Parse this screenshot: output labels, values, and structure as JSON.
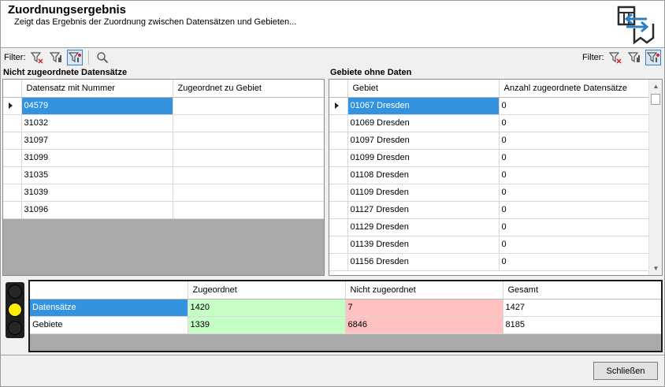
{
  "header": {
    "title": "Zuordnungsergebnis",
    "subtitle": "Zeigt das Ergebnis der Zuordnung zwischen Datensätzen und Gebieten..."
  },
  "filter_left": {
    "label": "Filter:"
  },
  "filter_right": {
    "label": "Filter:"
  },
  "left_panel": {
    "title": "Nicht zugeordnete Datensätze",
    "columns": [
      "Datensatz mit Nummer",
      "Zugeordnet zu Gebiet"
    ],
    "rows": [
      [
        "04579",
        ""
      ],
      [
        "31032",
        ""
      ],
      [
        "31097",
        ""
      ],
      [
        "31099",
        ""
      ],
      [
        "31035",
        ""
      ],
      [
        "31039",
        ""
      ],
      [
        "31096",
        ""
      ]
    ]
  },
  "right_panel": {
    "title": "Gebiete ohne Daten",
    "columns": [
      "Gebiet",
      "Anzahl zugeordnete Datensätze"
    ],
    "rows": [
      [
        "01067 Dresden",
        "0"
      ],
      [
        "01069 Dresden",
        "0"
      ],
      [
        "01097 Dresden",
        "0"
      ],
      [
        "01099 Dresden",
        "0"
      ],
      [
        "01108 Dresden",
        "0"
      ],
      [
        "01109 Dresden",
        "0"
      ],
      [
        "01127 Dresden",
        "0"
      ],
      [
        "01129 Dresden",
        "0"
      ],
      [
        "01139 Dresden",
        "0"
      ],
      [
        "01156 Dresden",
        "0"
      ]
    ]
  },
  "summary": {
    "columns": [
      "",
      "Zugeordnet",
      "Nicht zugeordnet",
      "Gesamt"
    ],
    "rows": [
      [
        "Datensätze",
        "1420",
        "7",
        "1427"
      ],
      [
        "Gebiete",
        "1339",
        "6846",
        "8185"
      ]
    ]
  },
  "traffic_light": {
    "active": "yellow"
  },
  "colors": {
    "selection": "#3393df",
    "assigned": "#c6ffc6",
    "unassigned": "#ffc0c0",
    "filter_active": "#d6e8f8"
  },
  "icons": [
    "filter-clear-icon",
    "filter-edit-icon",
    "filter-active-icon",
    "search-icon",
    "mapping-logo-icon"
  ],
  "buttons": {
    "close": "Schließen"
  }
}
